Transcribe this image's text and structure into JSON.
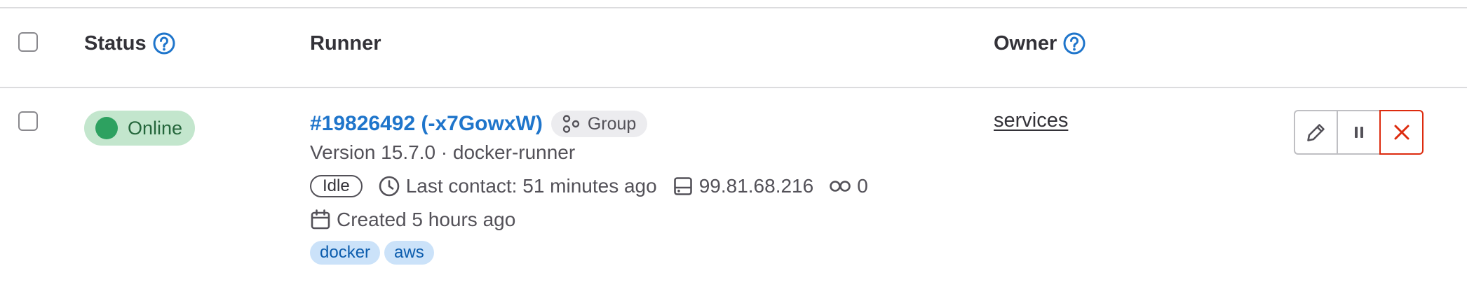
{
  "table": {
    "headers": {
      "status": "Status",
      "runner": "Runner",
      "owner": "Owner"
    }
  },
  "row": {
    "status": "Online",
    "runner_id": "#19826492 (-x7GowxW)",
    "runner_type": "Group",
    "version": "Version 15.7.0 · docker-runner",
    "job_status": "Idle",
    "last_contact": "Last contact: 51 minutes ago",
    "ip_address": "99.81.68.216",
    "jobs_count": "0",
    "created": "Created 5 hours ago",
    "tags": [
      "docker",
      "aws"
    ],
    "owner": "services"
  },
  "icons": {
    "help": "question-circle-icon",
    "group": "group-icon",
    "clock": "clock-icon",
    "machine": "disk-icon",
    "pipeline": "pipeline-icon",
    "calendar": "calendar-icon",
    "edit": "pencil-icon",
    "pause": "pause-icon",
    "delete": "close-icon"
  },
  "colors": {
    "online_badge_bg": "#c3e6cd",
    "online_dot": "#2da160",
    "link": "#1f75cb",
    "tag_bg": "#cbe2f9",
    "danger": "#dd2b0e"
  }
}
